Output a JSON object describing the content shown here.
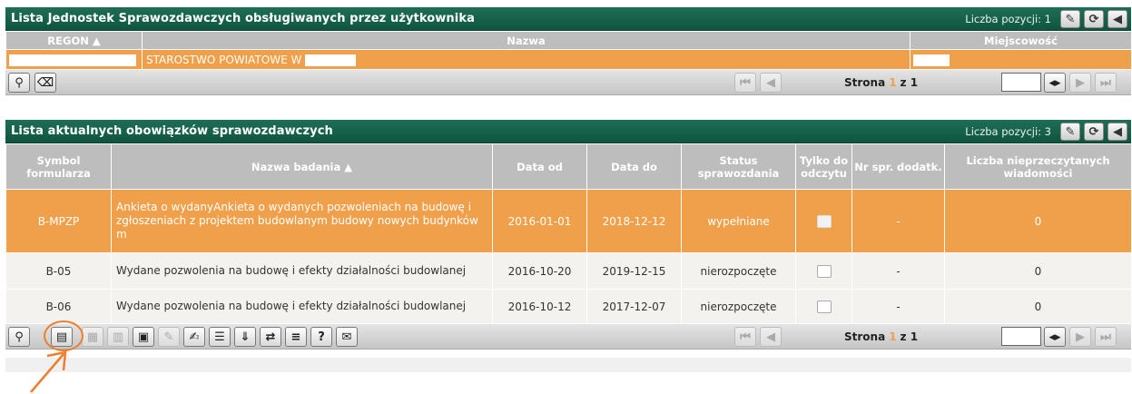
{
  "units_panel": {
    "title": "Lista Jednostek Sprawozdawczych obsługiwanych przez użytkownika",
    "count_label": "Liczba pozycji: 1",
    "columns": [
      "REGON ▲",
      "Nazwa",
      "Miejscowość"
    ],
    "row": {
      "nazwa": "STAROSTWO POWIATOWE W"
    },
    "pager": {
      "strona": "Strona",
      "current": "1",
      "of": "z 1"
    }
  },
  "duties_panel": {
    "title": "Lista aktualnych obowiązków sprawozdawczych",
    "count_label": "Liczba pozycji: 3",
    "columns": [
      "Symbol formularza",
      "Nazwa badania ▲",
      "Data od",
      "Data do",
      "Status sprawozdania",
      "Tylko do odczytu",
      "Nr spr. dodatk.",
      "Liczba nieprzeczytanych wiadomości"
    ],
    "rows": [
      {
        "symbol": "B-MPZP",
        "nazwa": "Ankieta o wydanyAnkieta o wydanych pozwoleniach na budowę i zgłoszeniach z projektem budowlanym budowy nowych budynków m",
        "od": "2016-01-01",
        "do": "2018-12-12",
        "status": "wypełniane",
        "nr": "-",
        "liczba": "0"
      },
      {
        "symbol": "B-05",
        "nazwa": "Wydane pozwolenia na budowę i efekty działalności budowlanej",
        "od": "2016-10-20",
        "do": "2019-12-15",
        "status": "nierozpoczęte",
        "nr": "-",
        "liczba": "0"
      },
      {
        "symbol": "B-06",
        "nazwa": "Wydane pozwolenia na budowę i efekty działalności budowlanej",
        "od": "2016-10-12",
        "do": "2017-12-07",
        "status": "nierozpoczęte",
        "nr": "-",
        "liczba": "0"
      }
    ],
    "pager": {
      "strona": "Strona",
      "current": "1",
      "of": "z 1"
    }
  },
  "colors": {
    "header": "#0f5540",
    "selected_row": "#f0a04b",
    "annotation": "#ef7d2b"
  }
}
